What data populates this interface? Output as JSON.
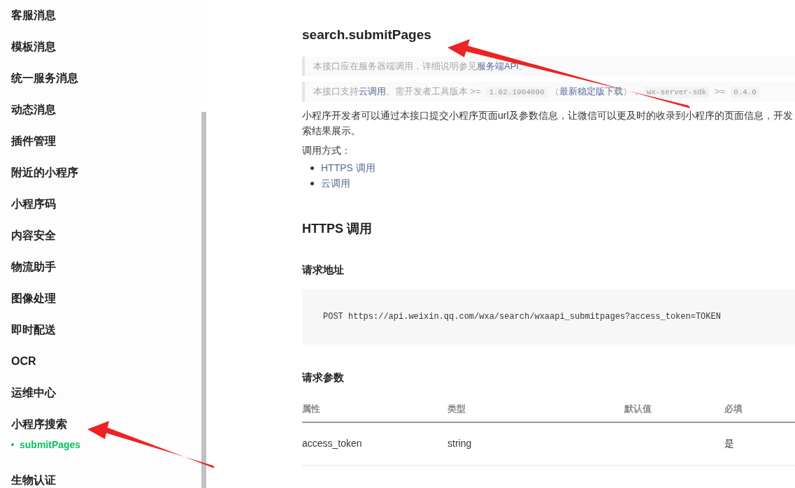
{
  "sidebar": {
    "items": [
      {
        "label": "客服消息"
      },
      {
        "label": "模板消息"
      },
      {
        "label": "统一服务消息"
      },
      {
        "label": "动态消息"
      },
      {
        "label": "插件管理"
      },
      {
        "label": "附近的小程序"
      },
      {
        "label": "小程序码"
      },
      {
        "label": "内容安全"
      },
      {
        "label": "物流助手"
      },
      {
        "label": "图像处理"
      },
      {
        "label": "即时配送"
      },
      {
        "label": "OCR"
      },
      {
        "label": "运维中心"
      },
      {
        "label": "小程序搜索",
        "children": [
          {
            "label": "submitPages",
            "selected": true
          }
        ]
      },
      {
        "label": "生物认证"
      }
    ]
  },
  "content": {
    "title": "search.submitPages",
    "notes": [
      [
        {
          "kind": "text",
          "text": "本接口应在服务器端调用，详细说明参见"
        },
        {
          "kind": "link",
          "text": "服务端API"
        },
        {
          "kind": "text",
          "text": "。"
        }
      ],
      [
        {
          "kind": "text",
          "text": "本接口支持"
        },
        {
          "kind": "link",
          "text": "云调用"
        },
        {
          "kind": "text",
          "text": "。需开发者工具版本 >= "
        },
        {
          "kind": "code",
          "text": "1.02.1904090"
        },
        {
          "kind": "text",
          "text": "（"
        },
        {
          "kind": "link",
          "text": "最新稳定版下载"
        },
        {
          "kind": "text",
          "text": "），"
        },
        {
          "kind": "code",
          "text": "wx-server-sdk"
        },
        {
          "kind": "text",
          "text": " >= "
        },
        {
          "kind": "code",
          "text": "0.4.0"
        }
      ]
    ],
    "description": [
      "小程序开发者可以通过本接口提交小程序页面url及参数信息，让微信可以更及时的收录到小程序的页面信息，开发",
      "索结果展示。"
    ],
    "call_label": "调用方式：",
    "call_methods": [
      "HTTPS 调用",
      "云调用"
    ],
    "section_title": "HTTPS 调用",
    "request_url_title": "请求地址",
    "request_url": "POST https://api.weixin.qq.com/wxa/search/wxaapi_submitpages?access_token=TOKEN",
    "params_title": "请求参数",
    "table": {
      "columns": [
        "属性",
        "类型",
        "默认值",
        "必填"
      ],
      "rows": [
        {
          "name": "access_token",
          "type": "string",
          "required": "是"
        }
      ]
    }
  }
}
